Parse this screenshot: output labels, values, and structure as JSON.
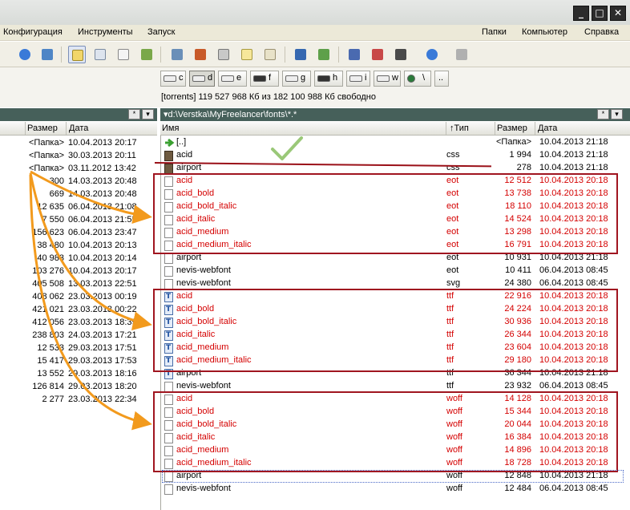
{
  "window": {
    "min": "_",
    "max": "□",
    "close": "✕"
  },
  "menu": {
    "left": [
      "Конфигурация",
      "Инструменты",
      "Запуск"
    ],
    "right": [
      "Папки",
      "Компьютер",
      "Справка"
    ]
  },
  "drives": [
    {
      "label": "c",
      "active": false
    },
    {
      "label": "d",
      "active": true
    },
    {
      "label": "e",
      "active": false
    },
    {
      "label": "f",
      "active": false
    },
    {
      "label": "g",
      "active": false
    },
    {
      "label": "h",
      "active": false
    },
    {
      "label": "i",
      "active": false
    },
    {
      "label": "w",
      "active": false
    },
    {
      "label": "\\",
      "active": false
    },
    {
      "label": "..",
      "active": false
    }
  ],
  "drive_info": "[torrents]  119 527 968 Кб из 182 100 988 Кб свободно",
  "right_path": "▾d:\\Verstka\\MyFreelancer\\fonts\\*.*",
  "left_path_buttons": [
    "*",
    "▾"
  ],
  "right_path_buttons": [
    "*",
    "▾"
  ],
  "left_header": {
    "size": "Размер",
    "date": "Дата"
  },
  "right_header": {
    "name": "Имя",
    "type": "↑Тип",
    "size": "Размер",
    "date": "Дата"
  },
  "left_rows": [
    {
      "size": "<Папка>",
      "date": "10.04.2013 20:17"
    },
    {
      "size": "<Папка>",
      "date": "30.03.2013 20:11"
    },
    {
      "size": "<Папка>",
      "date": "03.11.2012 13:42"
    },
    {
      "size": "300",
      "date": "14.03.2013 20:48"
    },
    {
      "size": "669",
      "date": "14.03.2013 20:48"
    },
    {
      "size": "12 635",
      "date": "06.04.2013 21:08"
    },
    {
      "size": "7 550",
      "date": "06.04.2013 21:55"
    },
    {
      "size": "156 623",
      "date": "06.04.2013 23:47"
    },
    {
      "size": "38 480",
      "date": "10.04.2013 20:13"
    },
    {
      "size": "40 983",
      "date": "10.04.2013 20:14"
    },
    {
      "size": "103 276",
      "date": "10.04.2013 20:17"
    },
    {
      "size": "405 508",
      "date": "13.03.2013 22:51"
    },
    {
      "size": "408 062",
      "date": "23.03.2013 00:19"
    },
    {
      "size": "421 021",
      "date": "23.03.2013 00:22"
    },
    {
      "size": "412 056",
      "date": "23.03.2013 18:39"
    },
    {
      "size": "238 803",
      "date": "24.03.2013 17:21"
    },
    {
      "size": "12 533",
      "date": "29.03.2013 17:51"
    },
    {
      "size": "15 417",
      "date": "29.03.2013 17:53"
    },
    {
      "size": "13 552",
      "date": "29.03.2013 18:16"
    },
    {
      "size": "126 814",
      "date": "29.03.2013 18:20"
    },
    {
      "size": "2 277",
      "date": "23.03.2013 22:34"
    }
  ],
  "right_rows": [
    {
      "icon": "up",
      "name": "[..]",
      "ext": "",
      "size": "<Папка>",
      "date": "10.04.2013 21:18",
      "red": false
    },
    {
      "icon": "css",
      "name": "acid",
      "ext": "css",
      "size": "1 994",
      "date": "10.04.2013 21:18",
      "red": false
    },
    {
      "icon": "css",
      "name": "airport",
      "ext": "css",
      "size": "278",
      "date": "10.04.2013 21:18",
      "red": false
    },
    {
      "icon": "file",
      "name": "acid",
      "ext": "eot",
      "size": "12 512",
      "date": "10.04.2013 20:18",
      "red": true
    },
    {
      "icon": "file",
      "name": "acid_bold",
      "ext": "eot",
      "size": "13 738",
      "date": "10.04.2013 20:18",
      "red": true
    },
    {
      "icon": "file",
      "name": "acid_bold_italic",
      "ext": "eot",
      "size": "18 110",
      "date": "10.04.2013 20:18",
      "red": true
    },
    {
      "icon": "file",
      "name": "acid_italic",
      "ext": "eot",
      "size": "14 524",
      "date": "10.04.2013 20:18",
      "red": true
    },
    {
      "icon": "file",
      "name": "acid_medium",
      "ext": "eot",
      "size": "13 298",
      "date": "10.04.2013 20:18",
      "red": true
    },
    {
      "icon": "file",
      "name": "acid_medium_italic",
      "ext": "eot",
      "size": "16 791",
      "date": "10.04.2013 20:18",
      "red": true
    },
    {
      "icon": "file",
      "name": "airport",
      "ext": "eot",
      "size": "10 931",
      "date": "10.04.2013 21:18",
      "red": false
    },
    {
      "icon": "file",
      "name": "nevis-webfont",
      "ext": "eot",
      "size": "10 411",
      "date": "06.04.2013 08:45",
      "red": false
    },
    {
      "icon": "file",
      "name": "nevis-webfont",
      "ext": "svg",
      "size": "24 380",
      "date": "06.04.2013 08:45",
      "red": false
    },
    {
      "icon": "ttf",
      "name": "acid",
      "ext": "ttf",
      "size": "22 916",
      "date": "10.04.2013 20:18",
      "red": true
    },
    {
      "icon": "ttf",
      "name": "acid_bold",
      "ext": "ttf",
      "size": "24 224",
      "date": "10.04.2013 20:18",
      "red": true
    },
    {
      "icon": "ttf",
      "name": "acid_bold_italic",
      "ext": "ttf",
      "size": "30 936",
      "date": "10.04.2013 20:18",
      "red": true
    },
    {
      "icon": "ttf",
      "name": "acid_italic",
      "ext": "ttf",
      "size": "26 344",
      "date": "10.04.2013 20:18",
      "red": true
    },
    {
      "icon": "ttf",
      "name": "acid_medium",
      "ext": "ttf",
      "size": "23 604",
      "date": "10.04.2013 20:18",
      "red": true
    },
    {
      "icon": "ttf",
      "name": "acid_medium_italic",
      "ext": "ttf",
      "size": "29 180",
      "date": "10.04.2013 20:18",
      "red": true
    },
    {
      "icon": "ttf",
      "name": "airport",
      "ext": "ttf",
      "size": "36 344",
      "date": "10.04.2013 21:18",
      "red": false
    },
    {
      "icon": "file",
      "name": "nevis-webfont",
      "ext": "ttf",
      "size": "23 932",
      "date": "06.04.2013 08:45",
      "red": false
    },
    {
      "icon": "file",
      "name": "acid",
      "ext": "woff",
      "size": "14 128",
      "date": "10.04.2013 20:18",
      "red": true
    },
    {
      "icon": "file",
      "name": "acid_bold",
      "ext": "woff",
      "size": "15 344",
      "date": "10.04.2013 20:18",
      "red": true
    },
    {
      "icon": "file",
      "name": "acid_bold_italic",
      "ext": "woff",
      "size": "20 044",
      "date": "10.04.2013 20:18",
      "red": true
    },
    {
      "icon": "file",
      "name": "acid_italic",
      "ext": "woff",
      "size": "16 384",
      "date": "10.04.2013 20:18",
      "red": true
    },
    {
      "icon": "file",
      "name": "acid_medium",
      "ext": "woff",
      "size": "14 896",
      "date": "10.04.2013 20:18",
      "red": true
    },
    {
      "icon": "file",
      "name": "acid_medium_italic",
      "ext": "woff",
      "size": "18 728",
      "date": "10.04.2013 20:18",
      "red": true
    },
    {
      "icon": "file",
      "name": "airport",
      "ext": "woff",
      "size": "12 848",
      "date": "10.04.2013 21:18",
      "red": false
    },
    {
      "icon": "file",
      "name": "nevis-webfont",
      "ext": "woff",
      "size": "12 484",
      "date": "06.04.2013 08:45",
      "red": false
    }
  ],
  "colors": {
    "highlight_text": "#d40000",
    "highlight_box": "#a01520",
    "arrow": "#f29a1d",
    "checkmark": "#9ac878",
    "path_bar": "#46605a"
  },
  "annotations": [
    "checkmark-icon",
    "orange-arrow",
    "red-underline",
    "red-group-box"
  ]
}
